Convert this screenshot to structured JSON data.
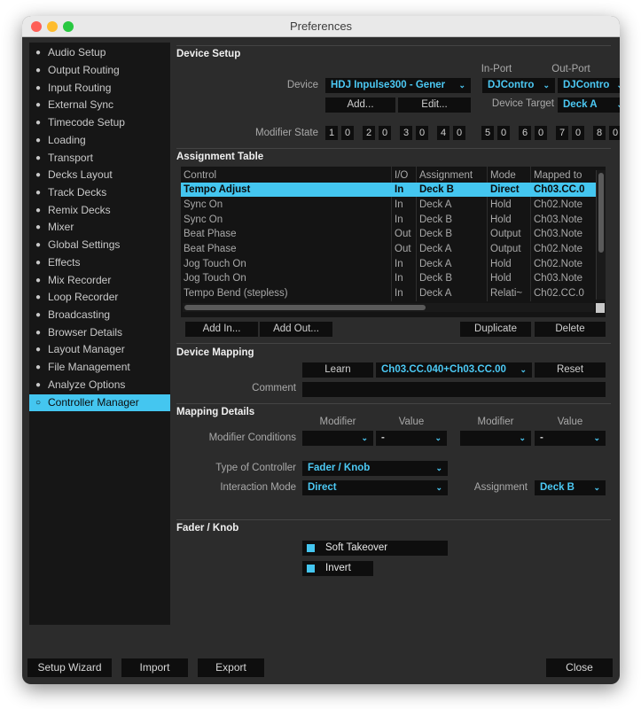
{
  "window": {
    "title": "Preferences"
  },
  "sidebar": {
    "items": [
      {
        "label": "Audio Setup"
      },
      {
        "label": "Output Routing"
      },
      {
        "label": "Input Routing"
      },
      {
        "label": "External Sync"
      },
      {
        "label": "Timecode Setup"
      },
      {
        "label": "Loading"
      },
      {
        "label": "Transport"
      },
      {
        "label": "Decks Layout"
      },
      {
        "label": "Track Decks"
      },
      {
        "label": "Remix Decks"
      },
      {
        "label": "Mixer"
      },
      {
        "label": "Global Settings"
      },
      {
        "label": "Effects"
      },
      {
        "label": "Mix Recorder"
      },
      {
        "label": "Loop Recorder"
      },
      {
        "label": "Broadcasting"
      },
      {
        "label": "Browser Details"
      },
      {
        "label": "Layout Manager"
      },
      {
        "label": "File Management"
      },
      {
        "label": "Analyze Options"
      },
      {
        "label": "Controller Manager"
      }
    ],
    "active_index": 20
  },
  "device_setup": {
    "header": "Device Setup",
    "device_label": "Device",
    "device_value": "HDJ Inpulse300 - Gener",
    "in_port_label": "In-Port",
    "out_port_label": "Out-Port",
    "in_port_value": "DJContro",
    "out_port_value": "DJContro",
    "add_label": "Add...",
    "edit_label": "Edit...",
    "device_target_label": "Device Target",
    "device_target_value": "Deck A",
    "modifier_state_label": "Modifier State",
    "modifiers": [
      {
        "n": "1",
        "v": "0"
      },
      {
        "n": "2",
        "v": "0"
      },
      {
        "n": "3",
        "v": "0"
      },
      {
        "n": "4",
        "v": "0"
      },
      {
        "n": "5",
        "v": "0"
      },
      {
        "n": "6",
        "v": "0"
      },
      {
        "n": "7",
        "v": "0"
      },
      {
        "n": "8",
        "v": "0"
      }
    ]
  },
  "assignment_table": {
    "header": "Assignment Table",
    "columns": {
      "control": "Control",
      "io": "I/O",
      "assignment": "Assignment",
      "mode": "Mode",
      "mapped": "Mapped to"
    },
    "rows": [
      {
        "control": "Tempo Adjust",
        "io": "In",
        "assignment": "Deck B",
        "mode": "Direct",
        "mapped": "Ch03.CC.0"
      },
      {
        "control": "Sync On",
        "io": "In",
        "assignment": "Deck A",
        "mode": "Hold",
        "mapped": "Ch02.Note"
      },
      {
        "control": "Sync On",
        "io": "In",
        "assignment": "Deck B",
        "mode": "Hold",
        "mapped": "Ch03.Note"
      },
      {
        "control": "Beat Phase",
        "io": "Out",
        "assignment": "Deck B",
        "mode": "Output",
        "mapped": "Ch03.Note"
      },
      {
        "control": "Beat Phase",
        "io": "Out",
        "assignment": "Deck A",
        "mode": "Output",
        "mapped": "Ch02.Note"
      },
      {
        "control": "Jog Touch On",
        "io": "In",
        "assignment": "Deck A",
        "mode": "Hold",
        "mapped": "Ch02.Note"
      },
      {
        "control": "Jog Touch On",
        "io": "In",
        "assignment": "Deck B",
        "mode": "Hold",
        "mapped": "Ch03.Note"
      },
      {
        "control": "Tempo Bend (stepless)",
        "io": "In",
        "assignment": "Deck A",
        "mode": "Relati~",
        "mapped": "Ch02.CC.0"
      }
    ],
    "selected_index": 0,
    "add_in_label": "Add In...",
    "add_out_label": "Add Out...",
    "duplicate_label": "Duplicate",
    "delete_label": "Delete"
  },
  "device_mapping": {
    "header": "Device Mapping",
    "learn_label": "Learn",
    "mapping_value": "Ch03.CC.040+Ch03.CC.00",
    "reset_label": "Reset",
    "comment_label": "Comment",
    "comment_value": ""
  },
  "mapping_details": {
    "header": "Mapping Details",
    "modifier_label": "Modifier",
    "value_label": "Value",
    "modifier_conditions_label": "Modifier Conditions",
    "cond1_modifier": "",
    "cond1_value": "-",
    "cond2_modifier": "",
    "cond2_value": "-",
    "type_label": "Type of Controller",
    "type_value": "Fader / Knob",
    "interaction_label": "Interaction Mode",
    "interaction_value": "Direct",
    "assignment_label": "Assignment",
    "assignment_value": "Deck B"
  },
  "fader_knob": {
    "header": "Fader / Knob",
    "soft_takeover_label": "Soft Takeover",
    "invert_label": "Invert"
  },
  "footer": {
    "setup_wizard_label": "Setup Wizard",
    "import_label": "Import",
    "export_label": "Export",
    "close_label": "Close"
  },
  "colors": {
    "accent": "#44c6f0",
    "background": "#2c2c2c",
    "control": "#0e0e0e"
  }
}
